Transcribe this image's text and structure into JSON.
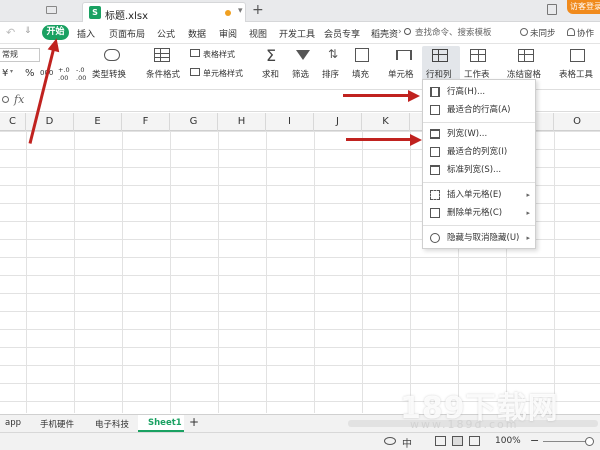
{
  "title_bar": {
    "file_name": "标题.xlsx",
    "file_icon_letter": "S",
    "new_tab": "+",
    "login_label": "访客登录"
  },
  "menu": {
    "start": "开始",
    "items": [
      "插入",
      "页面布局",
      "公式",
      "数据",
      "审阅",
      "视图",
      "开发工具",
      "会员专享",
      "稻壳资"
    ],
    "more": "›",
    "search_placeholder": "查找命令、搜索模板",
    "sync": "未同步",
    "collab": "协作"
  },
  "ribbon": {
    "font_value": "常规",
    "yen": "¥",
    "percent": "%",
    "thousand": "000",
    "inc_decimal": "+.0 .00",
    "dec_decimal": "-.0 .00",
    "type_convert": "类型转换",
    "cond_format": "条件格式",
    "table_style": "表格样式",
    "cell_style": "单元格样式",
    "sum": "求和",
    "filter": "筛选",
    "sort": "排序",
    "fill": "填充",
    "cell": "单元格",
    "row_col": "行和列",
    "worksheet": "工作表",
    "freeze": "冻结窗格",
    "table_tools": "表格工具"
  },
  "formula_bar": {
    "fx": "fx",
    "zoom": "Q"
  },
  "columns": [
    "C",
    "D",
    "E",
    "F",
    "G",
    "H",
    "I",
    "J",
    "K",
    "",
    "",
    "",
    "O"
  ],
  "dropdown": {
    "row_height": "行高(H)...",
    "best_row_height": "最适合的行高(A)",
    "col_width": "列宽(W)...",
    "best_col_width": "最适合的列宽(I)",
    "std_col_width": "标准列宽(S)...",
    "insert_cells": "插入单元格(E)",
    "delete_cells": "删除单元格(C)",
    "hide_unhide": "隐藏与取消隐藏(U)"
  },
  "sheets": {
    "tabs": [
      "app",
      "手机硬件",
      "电子科技",
      "Sheet1"
    ],
    "active": "Sheet1",
    "add": "+"
  },
  "status": {
    "zoom": "100%",
    "zoom_minus": "−"
  },
  "watermark": {
    "main": "189下载网",
    "sub": "www.189d.com"
  },
  "colors": {
    "accent": "#1aa162",
    "annotation_arrow": "#c0221f"
  }
}
